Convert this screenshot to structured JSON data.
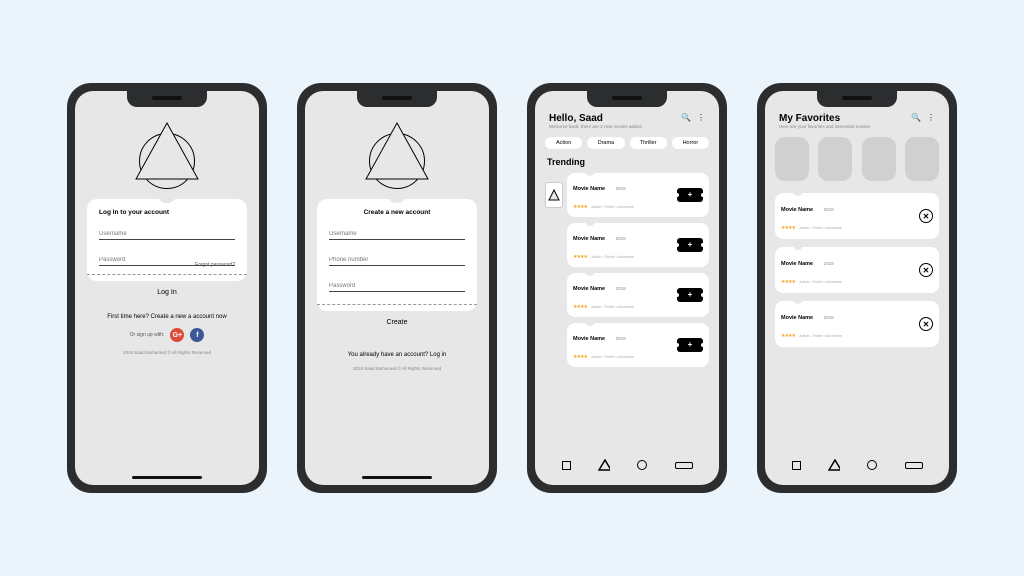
{
  "login": {
    "card_title": "Log In to your account",
    "username_ph": "Username",
    "password_ph": "Password",
    "forgot": "Forgot password?",
    "button": "Log In",
    "first_time": "First time here? Create a new a account now",
    "or_signup": "Or sign up with:",
    "copyright": "2019 Saad Muhamed © All Rights Reserved"
  },
  "signup": {
    "card_title": "Create a new account",
    "username_ph": "Username",
    "phone_ph": "Phone number",
    "password_ph": "Password",
    "button": "Create",
    "already": "You already have an account? Log in",
    "copyright": "2019 Saad Muhamed © All Rights Reserved"
  },
  "home": {
    "greeting": "Hello, Saad",
    "subtitle": "Welcome back, there are 2 new movies added",
    "chips": [
      "Action",
      "Drama",
      "Thriller",
      "Horror"
    ],
    "section": "Trending",
    "movies": [
      {
        "name": "Movie Name",
        "year": "2019",
        "meta": "Action • Thriller • Adventure"
      },
      {
        "name": "Movie Name",
        "year": "2019",
        "meta": "Action • Thriller • Adventure"
      },
      {
        "name": "Movie Name",
        "year": "2019",
        "meta": "Action • Thriller • Adventure"
      },
      {
        "name": "Movie Name",
        "year": "2019",
        "meta": "Action • Thriller • Adventure"
      }
    ]
  },
  "favorites": {
    "title": "My Favorites",
    "subtitle": "Here are your favorites and interested movies",
    "movies": [
      {
        "name": "Movie Name",
        "year": "2019",
        "meta": "Action • Thriller • Adventure"
      },
      {
        "name": "Movie Name",
        "year": "2019",
        "meta": "Action • Thriller • Adventure"
      },
      {
        "name": "Movie Name",
        "year": "2019",
        "meta": "Action • Thriller • Adventure"
      }
    ]
  },
  "icons": {
    "stars": "★★★★",
    "search": "🔍",
    "more": "⋮",
    "g": "G+",
    "f": "f",
    "plus": "+",
    "x": "✕"
  }
}
